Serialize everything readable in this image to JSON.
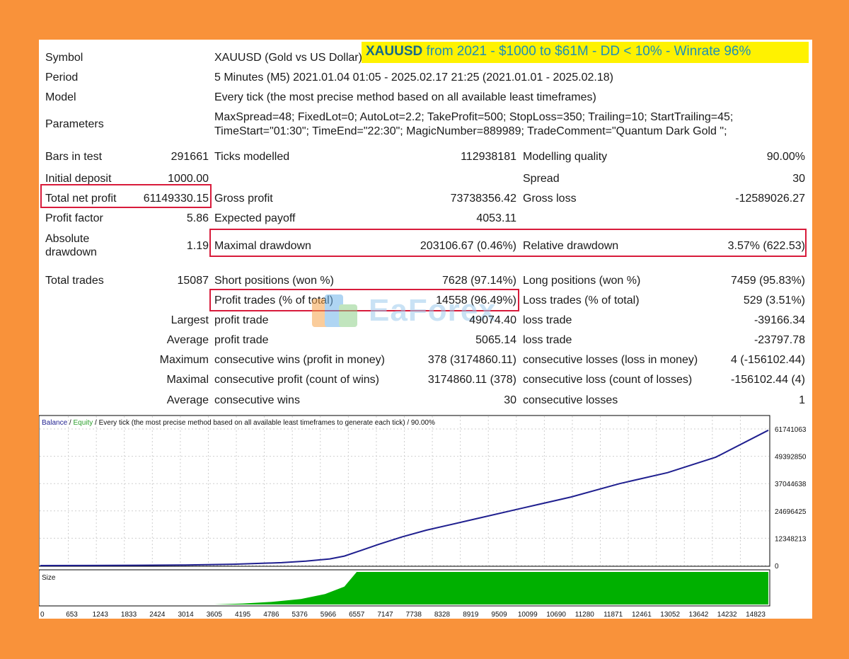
{
  "banner": {
    "symbol": "XAUUSD",
    "text": "from 2021 - $1000 to $61M - DD < 10% - Winrate 96%"
  },
  "header": {
    "symbol_label": "Symbol",
    "symbol_value": "XAUUSD (Gold vs US Dollar)",
    "period_label": "Period",
    "period_value": "5 Minutes (M5) 2021.01.04 01:05 - 2025.02.17 21:25 (2021.01.01 - 2025.02.18)",
    "model_label": "Model",
    "model_value": "Every tick (the most precise method based on all available least timeframes)",
    "parameters_label": "Parameters",
    "parameters_line1": "MaxSpread=48; FixedLot=0; AutoLot=2.2; TakeProfit=500; StopLoss=350; Trailing=10; StartTrailing=45;",
    "parameters_line2": "TimeStart=\"01:30\"; TimeEnd=\"22:30\"; MagicNumber=889989; TradeComment=\"Quantum Dark Gold \";"
  },
  "stats": {
    "bars_label": "Bars in test",
    "bars_value": "291661",
    "ticks_label": "Ticks modelled",
    "ticks_value": "112938181",
    "quality_label": "Modelling quality",
    "quality_value": "90.00%",
    "deposit_label": "Initial deposit",
    "deposit_value": "1000.00",
    "spread_label": "Spread",
    "spread_value": "30",
    "net_profit_label": "Total net profit",
    "net_profit_value": "61149330.15",
    "gross_profit_label": "Gross profit",
    "gross_profit_value": "73738356.42",
    "gross_loss_label": "Gross loss",
    "gross_loss_value": "-12589026.27",
    "profit_factor_label": "Profit factor",
    "profit_factor_value": "5.86",
    "payoff_label": "Expected payoff",
    "payoff_value": "4053.11",
    "abs_dd_label_1": "Absolute",
    "abs_dd_label_2": "drawdown",
    "abs_dd_value": "1.19",
    "max_dd_label": "Maximal drawdown",
    "max_dd_value": "203106.67 (0.46%)",
    "rel_dd_label": "Relative drawdown",
    "rel_dd_value": "3.57% (622.53)",
    "total_trades_label": "Total trades",
    "total_trades_value": "15087",
    "short_label": "Short positions (won %)",
    "short_value": "7628 (97.14%)",
    "long_label": "Long positions (won %)",
    "long_value": "7459 (95.83%)",
    "profit_trades_label": "Profit trades (% of total)",
    "profit_trades_value": "14558 (96.49%)",
    "loss_trades_label": "Loss trades (% of total)",
    "loss_trades_value": "529 (3.51%)",
    "largest_label": "Largest",
    "largest_profit_label": "profit trade",
    "largest_profit_value": "49074.40",
    "largest_loss_label": "loss trade",
    "largest_loss_value": "-39166.34",
    "average_label": "Average",
    "average_profit_label": "profit trade",
    "average_profit_value": "5065.14",
    "average_loss_label": "loss trade",
    "average_loss_value": "-23797.78",
    "maximum_label": "Maximum",
    "max_wins_label": "consecutive wins (profit in money)",
    "max_wins_value": "378 (3174860.11)",
    "max_losses_label": "consecutive losses (loss in money)",
    "max_losses_value": "4 (-156102.44)",
    "maximal_label": "Maximal",
    "maximal_profit_label": "consecutive profit (count of wins)",
    "maximal_profit_value": "3174860.11 (378)",
    "maximal_loss_label": "consecutive loss (count of losses)",
    "maximal_loss_value": "-156102.44 (4)",
    "avg_consec_label": "Average",
    "avg_wins_label": "consecutive wins",
    "avg_wins_value": "30",
    "avg_losses_label": "consecutive losses",
    "avg_losses_value": "1"
  },
  "watermark": {
    "text": "EaForex"
  },
  "chart_legend": {
    "balance": "Balance",
    "sep1": " / ",
    "equity": "Equity",
    "rest": " / Every tick (the most precise method based on all available least timeframes to generate each tick) / 90.00%"
  },
  "size_label": "Size",
  "colors": {
    "balance": "#1f1f8f",
    "equity": "#2ca02c",
    "size_fill": "#00b000",
    "highlight": "#d81b3b",
    "banner_bg": "#fff200"
  },
  "chart_data": [
    {
      "type": "line",
      "series": [
        {
          "name": "Balance",
          "x": [
            0,
            1000,
            2000,
            3000,
            4000,
            5000,
            5500,
            6000,
            6300,
            6600,
            7000,
            7500,
            8000,
            9000,
            10000,
            11000,
            12000,
            13000,
            14000,
            15087
          ],
          "y": [
            1000,
            40000,
            120000,
            250000,
            600000,
            1300000,
            2000000,
            3000000,
            4300000,
            6500000,
            9500000,
            13000000,
            16000000,
            21000000,
            26000000,
            31000000,
            37000000,
            42000000,
            49000000,
            61149330
          ]
        }
      ],
      "yticks": [
        "61741063",
        "49392850",
        "37044638",
        "24696425",
        "12348213",
        "0"
      ],
      "ylim": [
        0,
        61741063
      ],
      "xlim": [
        0,
        15087
      ],
      "grid": true
    },
    {
      "type": "area",
      "title": "Size",
      "x": [
        0,
        3600,
        4200,
        4800,
        5400,
        5900,
        6300,
        6557,
        15087
      ],
      "y": [
        0,
        0,
        0.03,
        0.08,
        0.17,
        0.32,
        0.55,
        1.0,
        1.0
      ],
      "ylim": [
        0,
        1
      ],
      "xticks": [
        "0",
        "653",
        "1243",
        "1833",
        "2424",
        "3014",
        "3605",
        "4195",
        "4786",
        "5376",
        "5966",
        "6557",
        "7147",
        "7738",
        "8328",
        "8919",
        "9509",
        "10099",
        "10690",
        "11280",
        "11871",
        "12461",
        "13052",
        "13642",
        "14232",
        "14823"
      ]
    }
  ]
}
